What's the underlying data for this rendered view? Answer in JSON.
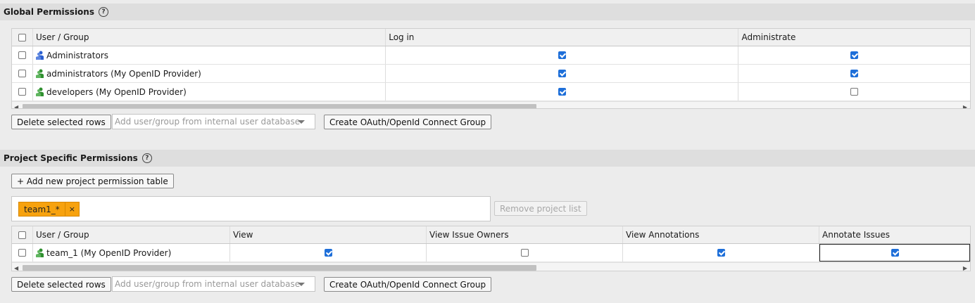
{
  "global": {
    "title": "Global Permissions",
    "help": "?",
    "columns": [
      "User / Group",
      "Log in",
      "Administrate"
    ],
    "rows": [
      {
        "name": "Administrators",
        "icon": "group-icon-blue",
        "login": true,
        "admin": true
      },
      {
        "name": "administrators (My OpenID Provider)",
        "icon": "group-icon-green",
        "login": true,
        "admin": true
      },
      {
        "name": "developers (My OpenID Provider)",
        "icon": "group-icon-green",
        "login": true,
        "admin": false
      }
    ],
    "delete_label": "Delete selected rows",
    "add_placeholder": "Add user/group from internal user database",
    "create_label": "Create OAuth/OpenId Connect Group"
  },
  "project": {
    "title": "Project Specific Permissions",
    "help": "?",
    "add_table_label": "+ Add new project permission table",
    "tag": "team1_*",
    "tag_remove": "×",
    "remove_list_label": "Remove project list",
    "columns": [
      "User / Group",
      "View",
      "View Issue Owners",
      "View Annotations",
      "Annotate Issues"
    ],
    "rows": [
      {
        "name": "team_1 (My OpenID Provider)",
        "icon": "group-icon-green",
        "view": true,
        "owners": false,
        "annotations": true,
        "annotate": true
      }
    ],
    "delete_label": "Delete selected rows",
    "add_placeholder": "Add user/group from internal user database",
    "create_label": "Create OAuth/OpenId Connect Group"
  },
  "colors": {
    "checkbox": "#1e6fd9",
    "tag": "#f7a20e",
    "group_blue": "#2a5fd1",
    "group_green": "#2f8f2f"
  }
}
